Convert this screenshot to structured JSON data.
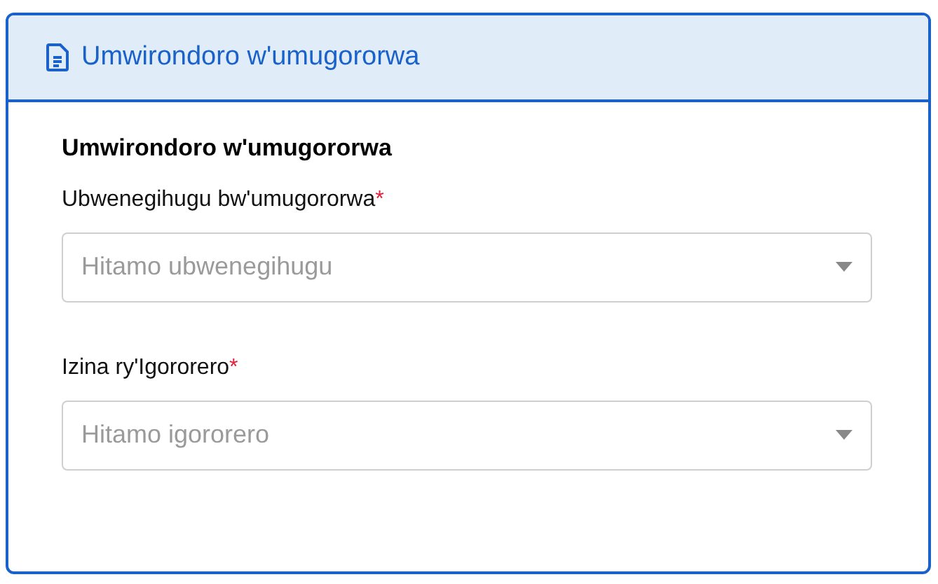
{
  "card": {
    "header_title": "Umwirondoro w'umugororwa",
    "section_title": "Umwirondoro w'umugororwa",
    "fields": [
      {
        "label": "Ubwenegihugu bw'umugororwa",
        "required_mark": "*",
        "placeholder": "Hitamo ubwenegihugu"
      },
      {
        "label": "Izina ry'Igororero",
        "required_mark": "*",
        "placeholder": "Hitamo igororero"
      }
    ]
  }
}
